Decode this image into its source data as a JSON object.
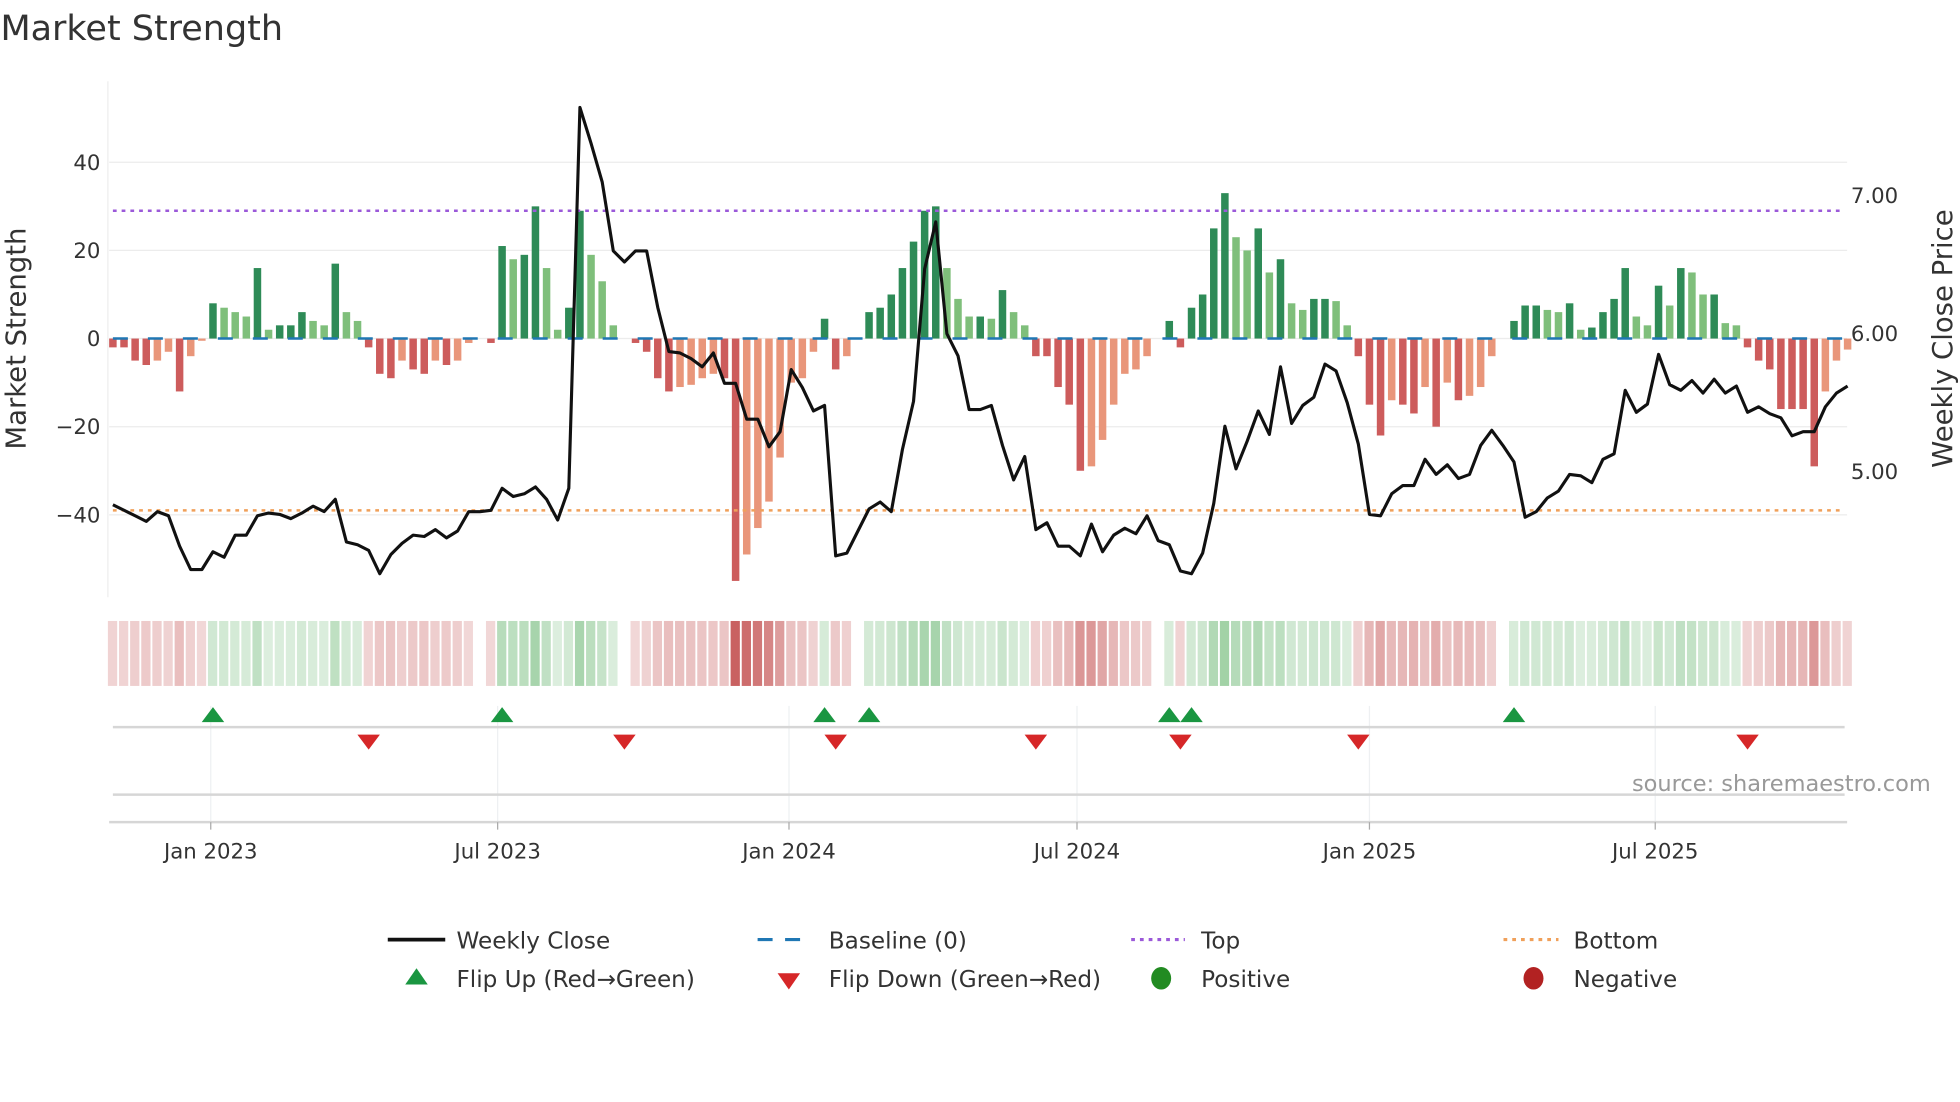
{
  "title": "Market Strength",
  "source": "source: sharemaestro.com",
  "colors": {
    "pos_strong": "#2e8b57",
    "pos_weak": "#7fbf7b",
    "neg_strong": "#cd5c5c",
    "neg_weak": "#e9967a",
    "line": "#111111",
    "baseline": "#1f77b4",
    "top": "#9b59d9",
    "bottom": "#f0a05a",
    "flip_up": "#1a9641",
    "flip_down": "#d62728",
    "positive": "#228b22",
    "negative": "#b22222"
  },
  "legend": {
    "weekly_close": "Weekly Close",
    "baseline": "Baseline (0)",
    "top": "Top",
    "bottom": "Bottom",
    "flip_up": "Flip Up (Red→Green)",
    "flip_down": "Flip Down (Green→Red)",
    "positive": "Positive",
    "negative": "Negative"
  },
  "chart_data": {
    "type": "bar",
    "title": "Market Strength",
    "ylabel": "Market Strength",
    "y2label": "Weekly Close Price",
    "xlabel": "",
    "ylim": [
      -58.7,
      58.4
    ],
    "y2lim": [
      4.09,
      7.83
    ],
    "yticks": [
      "40",
      "20",
      "0",
      "−20",
      "−40"
    ],
    "ytick_values": [
      40,
      20,
      0,
      -20,
      -40
    ],
    "y2ticks": [
      "7.00",
      "6.00",
      "5.00"
    ],
    "y2tick_values": [
      7,
      6,
      5
    ],
    "xticks": [
      {
        "label": "Jan 2023",
        "week": 8.8
      },
      {
        "label": "Jul 2023",
        "week": 34.6
      },
      {
        "label": "Jan 2024",
        "week": 60.8
      },
      {
        "label": "Jul 2024",
        "week": 86.7
      },
      {
        "label": "Jan 2025",
        "week": 113.0
      },
      {
        "label": "Jul 2025",
        "week": 138.7
      }
    ],
    "top_level": 29,
    "bottom_level": -39,
    "baseline": 0,
    "strength": [
      -2,
      -2,
      -5,
      -6,
      -5,
      -3,
      -12,
      -4,
      -0.5,
      8,
      7,
      6,
      5,
      16,
      2,
      3,
      3,
      6,
      4,
      3,
      17,
      6,
      4,
      -2,
      -8,
      -9,
      -5,
      -7,
      -8,
      -5,
      -6,
      -5,
      -1,
      0,
      -1,
      21,
      18,
      19,
      30,
      16,
      2,
      7,
      29,
      19,
      13,
      3,
      0,
      -1,
      -3,
      -9,
      -12,
      -11,
      -10.5,
      -9,
      -8,
      -9,
      -55,
      -49,
      -43,
      -37,
      -27,
      -10,
      -9,
      -3,
      4.5,
      -7,
      -4,
      0,
      6,
      7,
      10,
      16,
      22,
      29,
      30,
      16,
      9,
      5,
      5,
      4.5,
      11,
      6,
      3,
      -4,
      -4,
      -11,
      -15,
      -30,
      -29,
      -23,
      -15,
      -8,
      -7,
      -4,
      0,
      4,
      -2,
      7,
      10,
      25,
      33,
      23,
      20,
      25,
      15,
      18,
      8,
      6.5,
      9,
      9,
      8.5,
      3,
      -4,
      -15,
      -22,
      -14,
      -15,
      -17,
      -11,
      -20,
      -10,
      -14,
      -13,
      -11,
      -4,
      0,
      4,
      7.5,
      7.5,
      6.5,
      6,
      8,
      2,
      2.5,
      6,
      9,
      16,
      5,
      3,
      12,
      7.5,
      16,
      15,
      10,
      10,
      3.5,
      3,
      -2,
      -5,
      -7,
      -16,
      -16,
      -16,
      -29,
      -12,
      -5,
      -2.5
    ],
    "weekly_close": [
      4.76,
      4.72,
      4.68,
      4.64,
      4.71,
      4.68,
      4.46,
      4.29,
      4.29,
      4.42,
      4.38,
      4.54,
      4.54,
      4.68,
      4.7,
      4.69,
      4.66,
      4.7,
      4.75,
      4.71,
      4.8,
      4.49,
      4.47,
      4.43,
      4.26,
      4.4,
      4.48,
      4.54,
      4.53,
      4.58,
      4.52,
      4.57,
      4.71,
      4.71,
      4.72,
      4.88,
      4.82,
      4.84,
      4.89,
      4.8,
      4.65,
      4.88,
      7.64,
      7.38,
      7.1,
      6.6,
      6.52,
      6.6,
      6.6,
      6.19,
      5.87,
      5.86,
      5.82,
      5.76,
      5.86,
      5.64,
      5.64,
      5.38,
      5.38,
      5.18,
      5.29,
      5.74,
      5.61,
      5.44,
      5.48,
      4.39,
      4.41,
      4.57,
      4.73,
      4.78,
      4.71,
      5.16,
      5.51,
      6.47,
      6.81,
      6.0,
      5.84,
      5.45,
      5.45,
      5.48,
      5.19,
      4.94,
      5.11,
      4.58,
      4.63,
      4.46,
      4.46,
      4.39,
      4.62,
      4.42,
      4.54,
      4.59,
      4.55,
      4.68,
      4.5,
      4.47,
      4.28,
      4.26,
      4.41,
      4.77,
      5.33,
      5.02,
      5.22,
      5.44,
      5.27,
      5.76,
      5.35,
      5.48,
      5.54,
      5.78,
      5.73,
      5.5,
      5.2,
      4.69,
      4.68,
      4.84,
      4.9,
      4.9,
      5.09,
      4.98,
      5.05,
      4.95,
      4.98,
      5.19,
      5.3,
      5.19,
      5.07,
      4.67,
      4.71,
      4.81,
      4.86,
      4.98,
      4.97,
      4.92,
      5.09,
      5.13,
      5.59,
      5.43,
      5.49,
      5.85,
      5.63,
      5.59,
      5.66,
      5.57,
      5.67,
      5.57,
      5.62,
      5.43,
      5.47,
      5.42,
      5.39,
      5.26,
      5.29,
      5.29,
      5.47,
      5.57,
      5.62
    ],
    "flip_up_weeks": [
      9,
      35,
      64,
      68,
      95,
      97,
      126
    ],
    "flip_down_weeks": [
      23,
      46,
      65,
      83,
      96,
      112,
      147
    ],
    "grid": true,
    "legend_position": "bottom"
  }
}
